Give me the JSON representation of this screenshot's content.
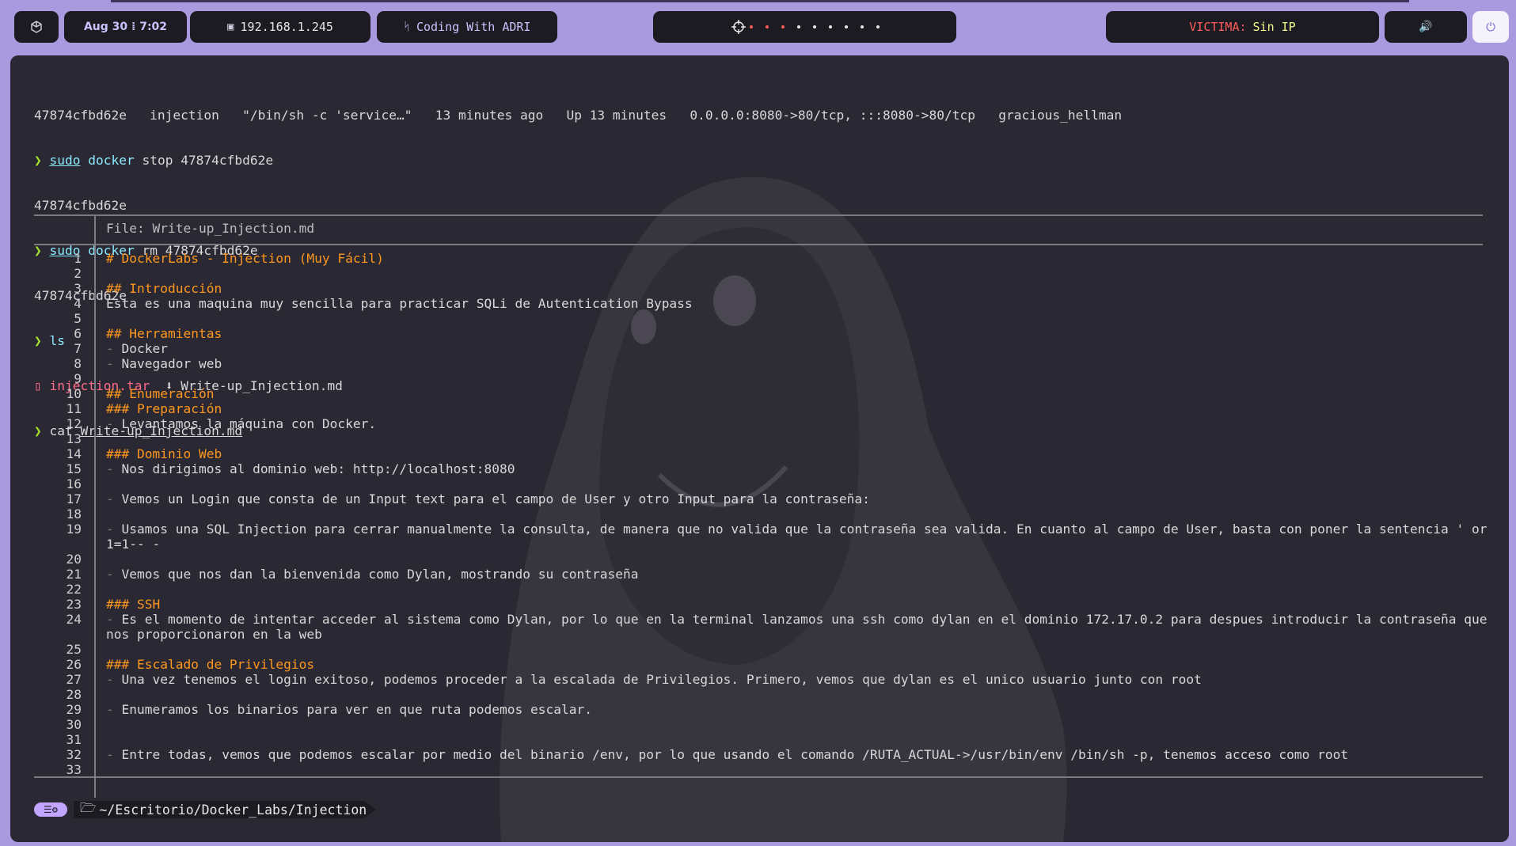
{
  "topbar": {
    "cube_icon": "cube-icon",
    "datetime": "Aug 30 ⁞ 7:02",
    "ip": "192.168.1.245",
    "project": "Coding With ADRI",
    "workspace_icon": "crosshair-icon",
    "target_label": "VICTIMA:",
    "target_value": "Sin IP",
    "volume_icon": "🔊",
    "power_icon": "⏻",
    "colors": {
      "target_label": "#ff5c5c",
      "target_value": "#f1fa8c",
      "pill": "#1c1b22",
      "bar": "#a99ae0"
    }
  },
  "terminal": {
    "lines": [
      {
        "text": "47874cfbd62e   injection   \"/bin/sh -c 'service…\"   13 minutes ago   Up 13 minutes   0.0.0.0:8080->80/tcp, :::8080->80/tcp   gracious_hellman"
      },
      {
        "prompt": "❯",
        "cmd1": "sudo",
        "cmd2": "docker",
        "rest": " stop 47874cfbd62e"
      },
      {
        "text": "47874cfbd62e"
      },
      {
        "prompt": "❯",
        "cmd1": "sudo",
        "cmd2": "docker",
        "rest": " rm 47874cfbd62e"
      },
      {
        "text": "47874cfbd62e"
      },
      {
        "prompt": "❯",
        "cmd2": "ls"
      },
      {
        "file1": "injection.tar",
        "file2": "Write-up_Injection.md"
      },
      {
        "prompt": "❯",
        "cmd2": "cat",
        "arg": "Write-up_Injection.md"
      }
    ],
    "file_header": "File: Write-up_Injection.md",
    "file_lines": [
      {
        "n": "1",
        "t": "# DockerLabs - Injection (Muy Fácil)",
        "k": "hdr"
      },
      {
        "n": "2",
        "t": ""
      },
      {
        "n": "3",
        "t": "## Introducción",
        "k": "hdr"
      },
      {
        "n": "4",
        "t": "Esta es una maquina muy sencilla para practicar SQLi de Autentication Bypass"
      },
      {
        "n": "5",
        "t": ""
      },
      {
        "n": "6",
        "t": "## Herramientas",
        "k": "hdr"
      },
      {
        "n": "7",
        "d": "- ",
        "t": "Docker"
      },
      {
        "n": "8",
        "d": "- ",
        "t": "Navegador web"
      },
      {
        "n": "9",
        "t": ""
      },
      {
        "n": "10",
        "t": "## Enumeración",
        "k": "hdr"
      },
      {
        "n": "11",
        "t": "### Preparación",
        "k": "hdr"
      },
      {
        "n": "12",
        "d": "- ",
        "t": "Levantamos la máquina con Docker."
      },
      {
        "n": "13",
        "t": ""
      },
      {
        "n": "14",
        "t": "### Dominio Web",
        "k": "hdr"
      },
      {
        "n": "15",
        "d": "- ",
        "t": "Nos dirigimos al dominio web: http://localhost:8080"
      },
      {
        "n": "16",
        "t": ""
      },
      {
        "n": "17",
        "d": "- ",
        "t": "Vemos un Login que consta de un Input text para el campo de User y otro Input para la contraseña:"
      },
      {
        "n": "18",
        "t": ""
      },
      {
        "n": "19",
        "d": "- ",
        "t": "Usamos una SQL Injection para cerrar manualmente la consulta, de manera que no valida que la contraseña sea valida. En cuanto al campo de User, basta con poner la sentencia ' or 1=1-- -",
        "wrap": true
      },
      {
        "n": "20",
        "t": ""
      },
      {
        "n": "21",
        "d": "- ",
        "t": "Vemos que nos dan la bienvenida como Dylan, mostrando su contraseña"
      },
      {
        "n": "22",
        "t": ""
      },
      {
        "n": "23",
        "t": "### SSH",
        "k": "hdr"
      },
      {
        "n": "24",
        "d": "- ",
        "t": "Es el momento de intentar acceder al sistema como Dylan, por lo que en la terminal lanzamos una ssh como dylan en el dominio 172.17.0.2 para despues introducir la contraseña que nos proporcionaron en la web",
        "wrap": true
      },
      {
        "n": "25",
        "t": ""
      },
      {
        "n": "26",
        "t": "### Escalado de Privilegios",
        "k": "hdr"
      },
      {
        "n": "27",
        "d": "- ",
        "t": "Una vez tenemos el login exitoso, podemos proceder a la escalada de Privilegios. Primero, vemos que dylan es el unico usuario junto con root"
      },
      {
        "n": "28",
        "t": ""
      },
      {
        "n": "29",
        "d": "- ",
        "t": "Enumeramos los binarios para ver en que ruta podemos escalar."
      },
      {
        "n": "30",
        "t": ""
      },
      {
        "n": "31",
        "t": ""
      },
      {
        "n": "32",
        "d": "- ",
        "t": "Entre todas, vemos que podemos escalar por medio del binario /env, por lo que usando el comando /RUTA_ACTUAL->/usr/bin/env /bin/sh -p, tenemos acceso como root"
      },
      {
        "n": "33",
        "t": ""
      }
    ],
    "prompt_badge": "☰⚙",
    "cwd": "~/Escritorio/Docker_Labs/Injection",
    "colors": {
      "heading": "#fd971f",
      "prompt": "#a6e22e",
      "cmd": "#8be9fd",
      "file_red": "#ff6b8a",
      "badge": "#c2a6ff"
    }
  }
}
